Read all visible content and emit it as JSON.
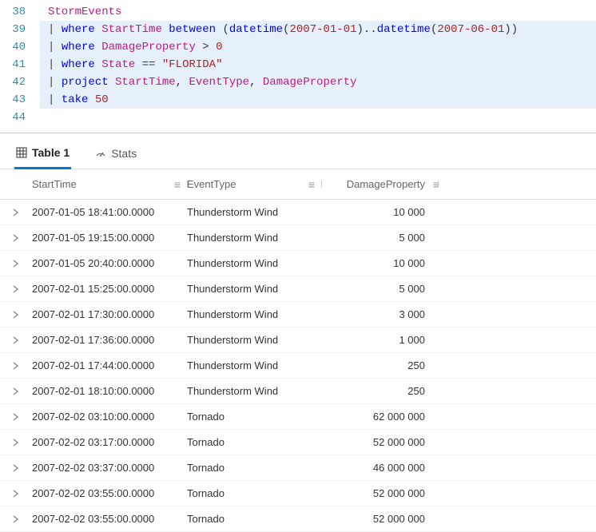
{
  "editor": {
    "lines": [
      {
        "num": "38",
        "hl": false,
        "tokens": [
          {
            "cls": "tk-table",
            "t": "StormEvents"
          }
        ]
      },
      {
        "num": "39",
        "hl": true,
        "tokens": [
          {
            "cls": "tk-pipe",
            "t": "| "
          },
          {
            "cls": "tk-keyword",
            "t": "where "
          },
          {
            "cls": "tk-column",
            "t": "StartTime "
          },
          {
            "cls": "tk-keyword",
            "t": "between "
          },
          {
            "cls": "tk-paren",
            "t": "("
          },
          {
            "cls": "tk-func",
            "t": "datetime"
          },
          {
            "cls": "tk-paren",
            "t": "("
          },
          {
            "cls": "tk-literal",
            "t": "2007-01-01"
          },
          {
            "cls": "tk-paren",
            "t": ")"
          },
          {
            "cls": "tk-op",
            "t": ".."
          },
          {
            "cls": "tk-func",
            "t": "datetime"
          },
          {
            "cls": "tk-paren",
            "t": "("
          },
          {
            "cls": "tk-literal",
            "t": "2007-06-01"
          },
          {
            "cls": "tk-paren",
            "t": "))"
          }
        ]
      },
      {
        "num": "40",
        "hl": true,
        "tokens": [
          {
            "cls": "tk-pipe",
            "t": "| "
          },
          {
            "cls": "tk-keyword",
            "t": "where "
          },
          {
            "cls": "tk-column",
            "t": "DamageProperty "
          },
          {
            "cls": "tk-op",
            "t": "> "
          },
          {
            "cls": "tk-num",
            "t": "0"
          }
        ]
      },
      {
        "num": "41",
        "hl": true,
        "tokens": [
          {
            "cls": "tk-pipe",
            "t": "| "
          },
          {
            "cls": "tk-keyword",
            "t": "where "
          },
          {
            "cls": "tk-column",
            "t": "State "
          },
          {
            "cls": "tk-op",
            "t": "== "
          },
          {
            "cls": "tk-string",
            "t": "\"FLORIDA\""
          }
        ]
      },
      {
        "num": "42",
        "hl": true,
        "tokens": [
          {
            "cls": "tk-pipe",
            "t": "| "
          },
          {
            "cls": "tk-keyword",
            "t": "project "
          },
          {
            "cls": "tk-column",
            "t": "StartTime"
          },
          {
            "cls": "tk-op",
            "t": ", "
          },
          {
            "cls": "tk-column",
            "t": "EventType"
          },
          {
            "cls": "tk-op",
            "t": ", "
          },
          {
            "cls": "tk-column",
            "t": "DamageProperty"
          }
        ]
      },
      {
        "num": "43",
        "hl": true,
        "tokens": [
          {
            "cls": "tk-pipe",
            "t": "| "
          },
          {
            "cls": "tk-keyword",
            "t": "take "
          },
          {
            "cls": "tk-num",
            "t": "50"
          }
        ]
      },
      {
        "num": "44",
        "hl": false,
        "tokens": []
      }
    ]
  },
  "tabs": {
    "table_label": "Table 1",
    "stats_label": "Stats"
  },
  "grid": {
    "columns": {
      "start": "StartTime",
      "event": "EventType",
      "damage": "DamageProperty"
    },
    "rows": [
      {
        "start": "2007-01-05 18:41:00.0000",
        "event": "Thunderstorm Wind",
        "damage": "10 000"
      },
      {
        "start": "2007-01-05 19:15:00.0000",
        "event": "Thunderstorm Wind",
        "damage": "5 000"
      },
      {
        "start": "2007-01-05 20:40:00.0000",
        "event": "Thunderstorm Wind",
        "damage": "10 000"
      },
      {
        "start": "2007-02-01 15:25:00.0000",
        "event": "Thunderstorm Wind",
        "damage": "5 000"
      },
      {
        "start": "2007-02-01 17:30:00.0000",
        "event": "Thunderstorm Wind",
        "damage": "3 000"
      },
      {
        "start": "2007-02-01 17:36:00.0000",
        "event": "Thunderstorm Wind",
        "damage": "1 000"
      },
      {
        "start": "2007-02-01 17:44:00.0000",
        "event": "Thunderstorm Wind",
        "damage": "250"
      },
      {
        "start": "2007-02-01 18:10:00.0000",
        "event": "Thunderstorm Wind",
        "damage": "250"
      },
      {
        "start": "2007-02-02 03:10:00.0000",
        "event": "Tornado",
        "damage": "62 000 000"
      },
      {
        "start": "2007-02-02 03:17:00.0000",
        "event": "Tornado",
        "damage": "52 000 000"
      },
      {
        "start": "2007-02-02 03:37:00.0000",
        "event": "Tornado",
        "damage": "46 000 000"
      },
      {
        "start": "2007-02-02 03:55:00.0000",
        "event": "Tornado",
        "damage": "52 000 000"
      },
      {
        "start": "2007-02-02 03:55:00.0000",
        "event": "Tornado",
        "damage": "52 000 000"
      }
    ]
  }
}
